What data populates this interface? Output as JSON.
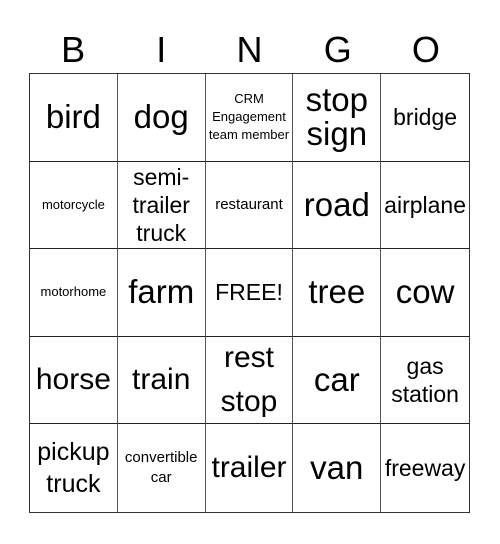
{
  "header": [
    "B",
    "I",
    "N",
    "G",
    "O"
  ],
  "cells": [
    {
      "text": "bird",
      "size": "s-xl"
    },
    {
      "text": "dog",
      "size": "s-xl"
    },
    {
      "text": "CRM Engagement team member",
      "size": "s-xs"
    },
    {
      "text": "stop sign",
      "size": "s-xl"
    },
    {
      "text": "bridge",
      "size": "s-m"
    },
    {
      "text": "motorcycle",
      "size": "s-xs"
    },
    {
      "text": "semi-trailer truck",
      "size": "s-m"
    },
    {
      "text": "restaurant",
      "size": "s-s"
    },
    {
      "text": "road",
      "size": "s-xl"
    },
    {
      "text": "airplane",
      "size": "s-m"
    },
    {
      "text": "motorhome",
      "size": "s-xs"
    },
    {
      "text": "farm",
      "size": "s-xl"
    },
    {
      "text": "FREE!",
      "size": "s-m"
    },
    {
      "text": "tree",
      "size": "s-xl"
    },
    {
      "text": "cow",
      "size": "s-xl"
    },
    {
      "text": "horse",
      "size": "s-l"
    },
    {
      "text": "train",
      "size": "s-l"
    },
    {
      "text": "rest stop",
      "size": "s-l"
    },
    {
      "text": "car",
      "size": "s-xl"
    },
    {
      "text": "gas station",
      "size": "s-m"
    },
    {
      "text": "pickup truck",
      "size": "s-ml"
    },
    {
      "text": "convertible car",
      "size": "s-s"
    },
    {
      "text": "trailer",
      "size": "s-l"
    },
    {
      "text": "van",
      "size": "s-xl"
    },
    {
      "text": "freeway",
      "size": "s-m"
    }
  ]
}
